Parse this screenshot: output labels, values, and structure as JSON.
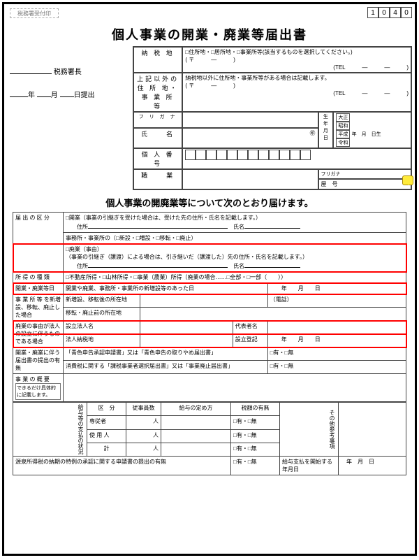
{
  "form_code": [
    "1",
    "0",
    "4",
    "0"
  ],
  "stamp_label": "税務署受付印",
  "title": "個人事業の開業・廃業等届出書",
  "addressee": "税務署長",
  "submit_suffix_year": "年",
  "submit_suffix_month": "月",
  "submit_suffix_day": "日提出",
  "upper": {
    "nozei_lbl": "納 税 地",
    "nozei_opts": "□住所地・□居所地・□事業所等(該当するものを選択してください。)",
    "postal": "( 〒　　　―　　　)",
    "tel": "(TEL　　　―　　　―　　　)",
    "other_lbl": "上記以外の住 所 地・事 業 所 等",
    "other_note": "納税地以外に住所地・事業所等がある場合は記載します。",
    "furigana_lbl": "フ リ ガ ナ",
    "name_lbl": "氏　　名",
    "stamp": "㊞",
    "birth_lbl": "生年月日",
    "eras": [
      "大正",
      "昭和",
      "平成",
      "令和"
    ],
    "birth_tail": "年　月　日生",
    "num_lbl": "個 人 番 号",
    "job_lbl": "職　　業",
    "trade_furi": "フリガナ",
    "trade_lbl": "屋　号"
  },
  "sec_hdr": "個人事業の開廃業等について次のとおり届けます。",
  "rows": {
    "kubun_lbl": "届 出 の 区 分",
    "kubun_open": "□開業（事業の引継ぎを受けた場合は、受けた先の住所・氏名を記載します。）",
    "kubun_addr": "住所",
    "kubun_name": "氏名",
    "kubun_office": "事務所・事業所の（□新設・□増設・□移転・□廃止）",
    "kubun_close": "□廃業（事由）",
    "kubun_close_note": "（事業の引継ぎ（譲渡）による場合は、引き継いだ（譲渡した）先の住所・氏名を記載します。）",
    "shotoku_lbl": "所 得 の 種 類",
    "shotoku_body": "□不動産所得・□山林所得・□事業（農業）所得（廃業の場合……□全部・□一部（　　））",
    "date_lbl": "開業・廃業等日",
    "date_body": "開業や廃業、事務所・事業所の新増設等のあった日",
    "y": "年",
    "m": "月",
    "d": "日",
    "office_lbl": "事 業 所 等 を新増設、移転、廃止した場合",
    "office_new": "新増設、移転後の所在地",
    "office_tel": "（電話）",
    "office_old": "移転・廃止前の所在地",
    "corp_lbl": "廃業の事由が法人の設立に伴うものである場合",
    "corp_name": "設立法人名",
    "corp_rep": "代表者名",
    "corp_addr": "法人納税地",
    "corp_reg": "設立登記",
    "reason_lbl": "開業・廃業に伴う届出書の提出の有無",
    "reason_blue": "「青色申告承認申請書」又は「青色申告の取りやめ届出書」",
    "reason_tax": "消費税に関する「課税事業者選択届出書」又は「事業廃止届出書」",
    "yesno": "□有・□無",
    "summary_lbl": "事 業 の 概 要",
    "summary_note": "できるだけ具体的に記載します。",
    "pay_side": "給与等の支払の状況",
    "pay_hdr": [
      "区　分",
      "従事員数",
      "給与の定め方",
      "税額の有無"
    ],
    "pay_rows": [
      "専従者",
      "使 用 人",
      "計"
    ],
    "pay_cnt": "人",
    "other_lbl": "その他参考事項",
    "withholding_lbl": "源泉所得税の納期の特例の承認に関する申請書の提出の有無",
    "startpay_lbl": "給与支払を開始する年月日"
  }
}
